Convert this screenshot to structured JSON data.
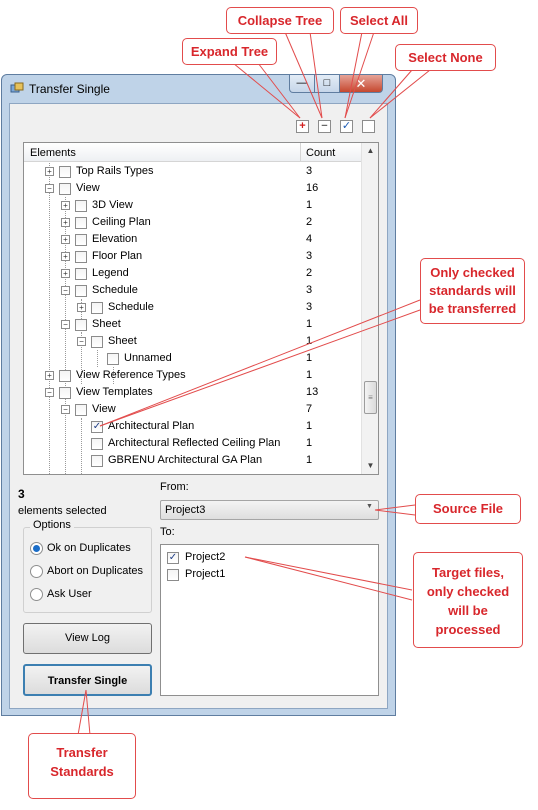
{
  "window": {
    "title": "Transfer Single",
    "min_glyph": "—",
    "max_glyph": "□",
    "close_glyph": "✕"
  },
  "toolbar": {
    "expand_glyph": "+",
    "collapse_glyph": "−",
    "select_all_glyph": "✓",
    "select_none_glyph": ""
  },
  "tree": {
    "col_elements": "Elements",
    "col_count": "Count",
    "scroll_up": "▲",
    "scroll_down": "▼",
    "thumb_grip": "≡",
    "rows": [
      {
        "label": "Top Rails Types",
        "count": "3",
        "checked": false,
        "expander": "+"
      },
      {
        "label": "View",
        "count": "16",
        "checked": false,
        "expander": "−"
      },
      {
        "label": "3D View",
        "count": "1",
        "checked": false,
        "expander": "+"
      },
      {
        "label": "Ceiling Plan",
        "count": "2",
        "checked": false,
        "expander": "+"
      },
      {
        "label": "Elevation",
        "count": "4",
        "checked": false,
        "expander": "+"
      },
      {
        "label": "Floor Plan",
        "count": "3",
        "checked": false,
        "expander": "+"
      },
      {
        "label": "Legend",
        "count": "2",
        "checked": false,
        "expander": "+"
      },
      {
        "label": "Schedule",
        "count": "3",
        "checked": false,
        "expander": "−"
      },
      {
        "label": "Schedule",
        "count": "3",
        "checked": false,
        "expander": "+"
      },
      {
        "label": "Sheet",
        "count": "1",
        "checked": false,
        "expander": "−"
      },
      {
        "label": "Sheet",
        "count": "1",
        "checked": false,
        "expander": "−"
      },
      {
        "label": "Unnamed",
        "count": "1",
        "checked": false,
        "expander": ""
      },
      {
        "label": "View Reference Types",
        "count": "1",
        "checked": false,
        "expander": "+"
      },
      {
        "label": "View Templates",
        "count": "13",
        "checked": false,
        "expander": "−"
      },
      {
        "label": "View",
        "count": "7",
        "checked": false,
        "expander": "−"
      },
      {
        "label": "Architectural Plan",
        "count": "1",
        "checked": true,
        "expander": ""
      },
      {
        "label": "Architectural Reflected Ceiling Plan",
        "count": "1",
        "checked": false,
        "expander": ""
      },
      {
        "label": "GBRENU Architectural GA Plan",
        "count": "1",
        "checked": false,
        "expander": ""
      }
    ]
  },
  "selection": {
    "count": "3",
    "label": "elements selected"
  },
  "options": {
    "title": "Options",
    "items": [
      {
        "label": "Ok on Duplicates",
        "selected": true
      },
      {
        "label": "Abort on Duplicates",
        "selected": false
      },
      {
        "label": "Ask User",
        "selected": false
      }
    ]
  },
  "buttons": {
    "view_log": "View Log",
    "transfer": "Transfer Single"
  },
  "from": {
    "label": "From:",
    "value": "Project3",
    "arrow": "▼"
  },
  "to": {
    "label": "To:",
    "items": [
      {
        "label": "Project2",
        "checked": true
      },
      {
        "label": "Project1",
        "checked": false
      }
    ]
  },
  "callouts": {
    "expand_tree": "Expand Tree",
    "collapse_tree": "Collapse Tree",
    "select_all": "Select All",
    "select_none": "Select None",
    "only_checked_standards": "Only checked standards will be transferred",
    "source_file": "Source File",
    "target_files": "Target files, only checked will be processed",
    "transfer_standards": "Transfer Standards"
  },
  "colors": {
    "callout": "#d8272c",
    "window_frame": "#bfd3e8",
    "checkmark": "#1f3e86"
  }
}
